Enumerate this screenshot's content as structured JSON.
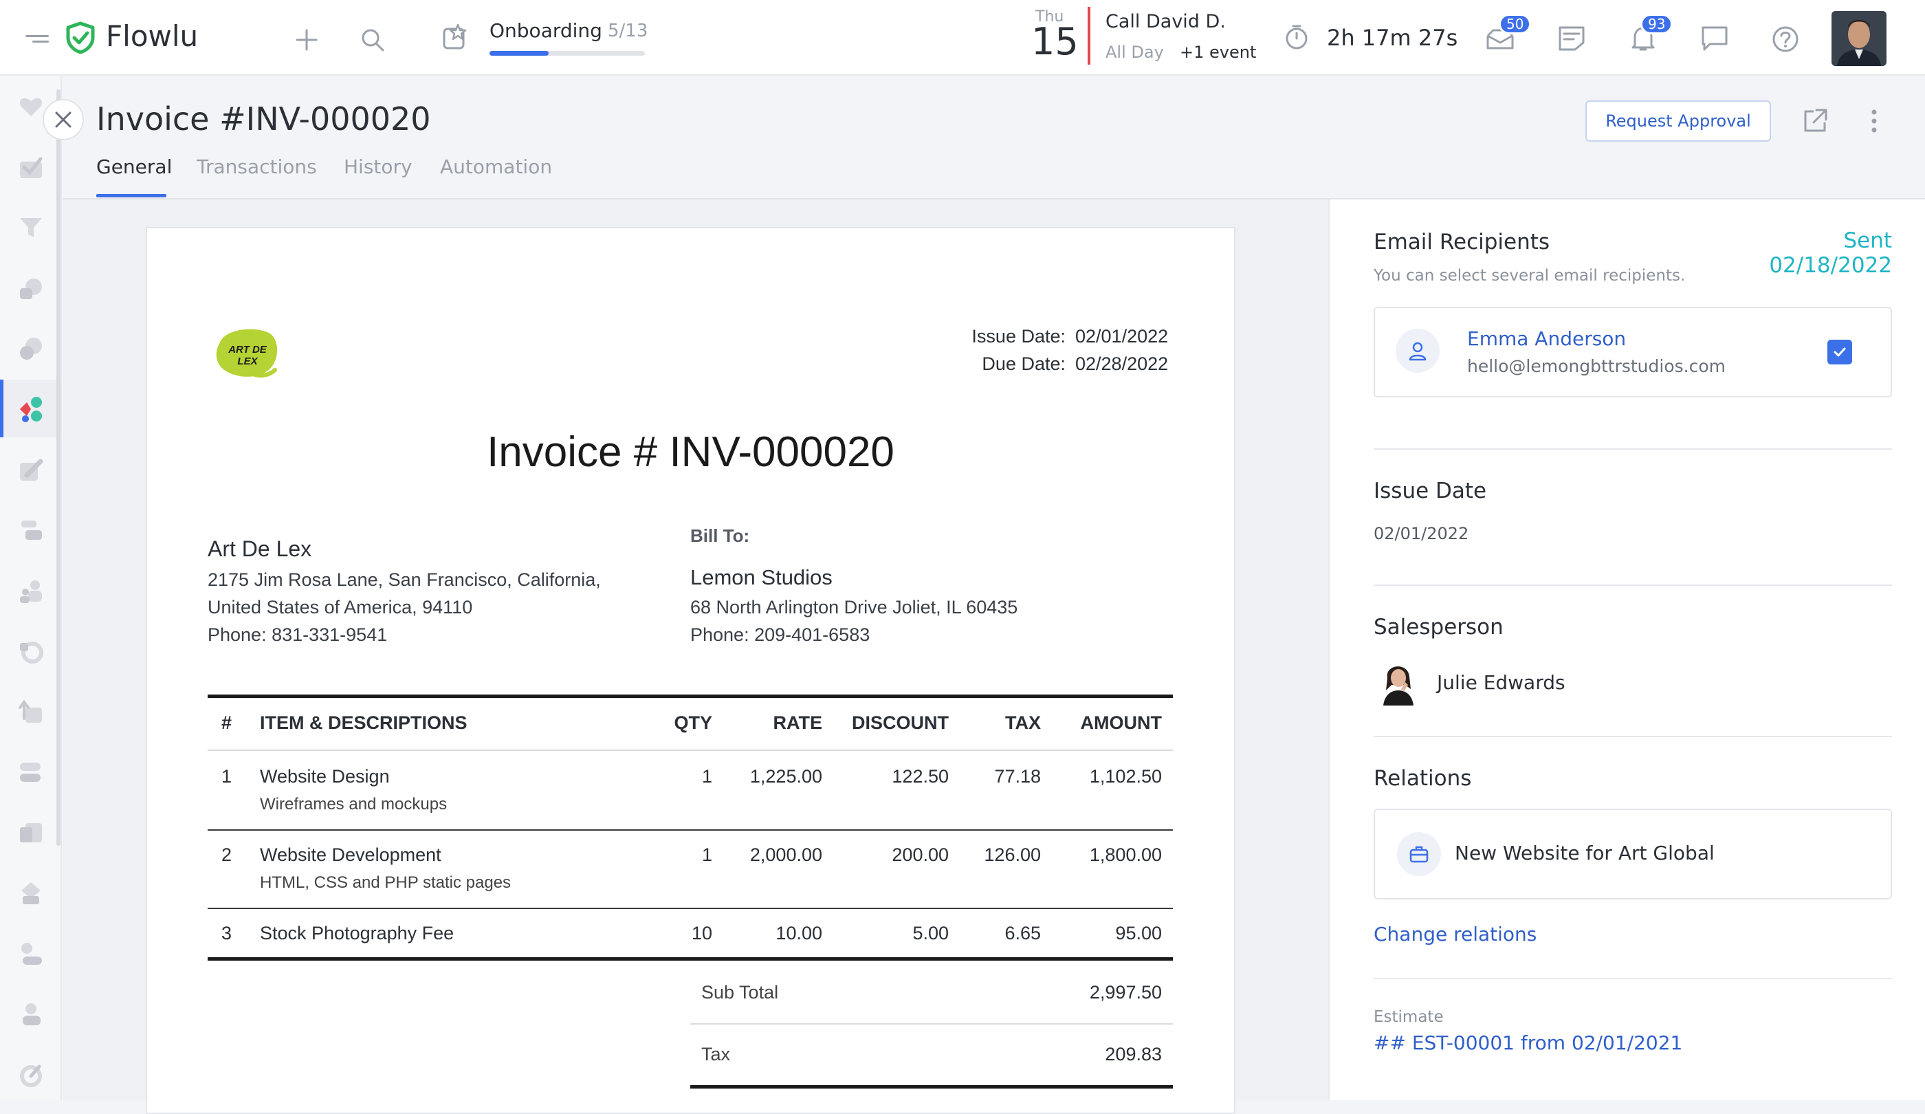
{
  "app": {
    "name": "Flowlu"
  },
  "topbar": {
    "onboarding_label": "Onboarding",
    "onboarding_count": "5/13",
    "onboarding_progress": 0.38,
    "cal_day": "Thu",
    "cal_date": "15",
    "event_title": "Call David D.",
    "event_time": "All Day",
    "event_more": "+1 event",
    "timer": "2h 17m 27s",
    "mail_badge": "50",
    "notif_badge": "93"
  },
  "page": {
    "title": "Invoice #INV-000020",
    "request_approval": "Request Approval",
    "tabs": [
      "General",
      "Transactions",
      "History",
      "Automation"
    ]
  },
  "invoice": {
    "logo_text": "ART DE LEX",
    "issue_label": "Issue Date:",
    "issue_date": "02/01/2022",
    "due_label": "Due Date:",
    "due_date": "02/28/2022",
    "heading": "Invoice # INV-000020",
    "from": {
      "name": "Art De Lex",
      "address1": "2175 Jim Rosa Lane, San Francisco, California,",
      "address2": "United States of America, 94110",
      "phone": "Phone: 831-331-9541"
    },
    "bill_to_label": "Bill To:",
    "to": {
      "name": "Lemon Studios",
      "address": "68 North Arlington Drive Joliet, IL 60435",
      "phone": "Phone: 209-401-6583"
    },
    "columns": [
      "#",
      "ITEM & DESCRIPTIONS",
      "QTY",
      "RATE",
      "DISCOUNT",
      "TAX",
      "AMOUNT"
    ],
    "rows": [
      {
        "n": "1",
        "item": "Website Design",
        "desc": "Wireframes and mockups",
        "qty": "1",
        "rate": "1,225.00",
        "discount": "122.50",
        "tax": "77.18",
        "amount": "1,102.50"
      },
      {
        "n": "2",
        "item": "Website Development",
        "desc": "HTML, CSS and PHP static pages",
        "qty": "1",
        "rate": "2,000.00",
        "discount": "200.00",
        "tax": "126.00",
        "amount": "1,800.00"
      },
      {
        "n": "3",
        "item": "Stock Photography Fee",
        "desc": "",
        "qty": "10",
        "rate": "10.00",
        "discount": "5.00",
        "tax": "6.65",
        "amount": "95.00"
      }
    ],
    "subtotal_label": "Sub Total",
    "subtotal": "2,997.50",
    "tax_label": "Tax",
    "tax": "209.83"
  },
  "panel": {
    "recipients_title": "Email Recipients",
    "sent": "Sent 02/18/2022",
    "recipients_hint": "You can select several email recipients.",
    "recipient_name": "Emma Anderson",
    "recipient_email": "hello@lemongbttrstudios.com",
    "issue_title": "Issue Date",
    "issue_value": "02/01/2022",
    "salesperson_title": "Salesperson",
    "salesperson_name": "Julie Edwards",
    "relations_title": "Relations",
    "relation_name": "New Website for Art Global",
    "change_relations": "Change relations",
    "estimate_label": "Estimate",
    "estimate_link": "## EST-00001 from 02/01/2021"
  },
  "colors": {
    "accent": "#3c70e8",
    "sent": "#1fb5c4",
    "logo_green": "#b5d334",
    "brand_green": "#2fb55a",
    "event_red": "#e5484d"
  }
}
